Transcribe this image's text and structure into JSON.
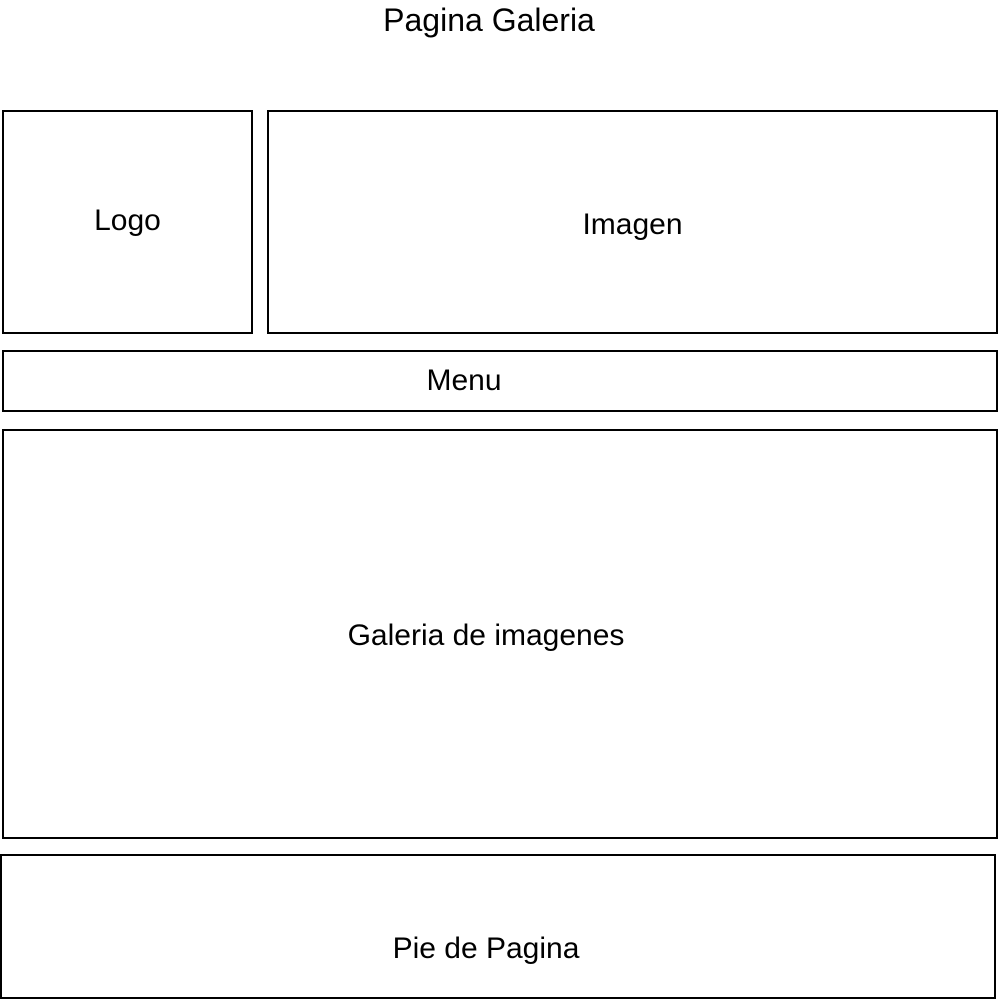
{
  "page": {
    "title": "Pagina Galeria"
  },
  "sections": {
    "logo": "Logo",
    "image": "Imagen",
    "menu": "Menu",
    "gallery": "Galeria de imagenes",
    "footer": "Pie de Pagina"
  },
  "colors": {
    "background": "#ffffff",
    "stroke": "#000000",
    "text": "#000000"
  }
}
